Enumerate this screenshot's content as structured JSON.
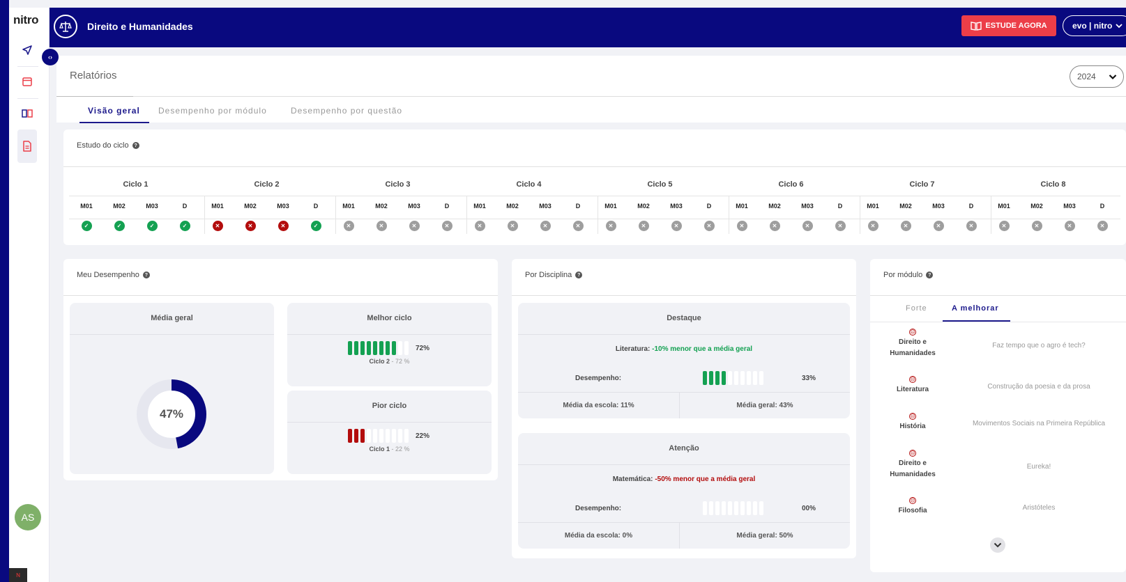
{
  "sidebar": {
    "logo": "nitro",
    "items": [
      {
        "name": "send-icon"
      },
      {
        "name": "calendar-icon"
      },
      {
        "name": "book-icon"
      },
      {
        "name": "report-icon",
        "active": true
      }
    ],
    "avatar_initials": "AS",
    "footer_logo": "nitro-badge-icon"
  },
  "header": {
    "course_title": "Direito e Humanidades",
    "study_button": "ESTUDE AGORA",
    "user_menu": "evo | nitro"
  },
  "page": {
    "title": "Relatórios",
    "year": "2024",
    "tabs": [
      "Visão geral",
      "Desempenho por módulo",
      "Desempenho por questão"
    ],
    "active_tab": "Visão geral"
  },
  "ciclo": {
    "title": "Estudo do ciclo",
    "modules": [
      "M01",
      "M02",
      "M03",
      "D"
    ],
    "cycles": [
      {
        "name": "Ciclo 1",
        "status": [
          "ok",
          "ok",
          "ok",
          "ok"
        ]
      },
      {
        "name": "Ciclo 2",
        "status": [
          "bad",
          "bad",
          "bad",
          "ok"
        ]
      },
      {
        "name": "Ciclo 3",
        "status": [
          "na",
          "na",
          "na",
          "na"
        ]
      },
      {
        "name": "Ciclo 4",
        "status": [
          "na",
          "na",
          "na",
          "na"
        ]
      },
      {
        "name": "Ciclo 5",
        "status": [
          "na",
          "na",
          "na",
          "na"
        ]
      },
      {
        "name": "Ciclo 6",
        "status": [
          "na",
          "na",
          "na",
          "na"
        ]
      },
      {
        "name": "Ciclo 7",
        "status": [
          "na",
          "na",
          "na",
          "na"
        ]
      },
      {
        "name": "Ciclo 8",
        "status": [
          "na",
          "na",
          "na",
          "na"
        ]
      }
    ]
  },
  "meu_desempenho": {
    "title": "Meu Desempenho",
    "media_geral_title": "Média geral",
    "media_geral_value": "47%",
    "media_geral_fraction": 0.47,
    "melhor_ciclo": {
      "title": "Melhor ciclo",
      "pct": "72%",
      "cycle": "Ciclo 2",
      "detail": " - 72 %",
      "filled": 8,
      "total": 10
    },
    "pior_ciclo": {
      "title": "Pior ciclo",
      "pct": "22%",
      "cycle": "Ciclo 1",
      "detail": " - 22 %",
      "filled": 3,
      "total": 10
    }
  },
  "por_disciplina": {
    "title": "Por Disciplina",
    "destaque": {
      "title": "Destaque",
      "subject": "Literatura:",
      "delta": "-10% menor que a média geral",
      "desempenho_label": "Desempenho:",
      "pct": "33%",
      "filled": 4,
      "total": 10,
      "media_escola": "Média da escola: 11%",
      "media_geral": "Média geral: 43%"
    },
    "atencao": {
      "title": "Atenção",
      "subject": "Matemática:",
      "delta": "-50% menor que a média geral",
      "desempenho_label": "Desempenho:",
      "pct": "00%",
      "filled": 0,
      "total": 10,
      "media_escola": "Média da escola: 0%",
      "media_geral": "Média geral: 50%"
    }
  },
  "por_modulo": {
    "title": "Por módulo",
    "tabs": [
      "Forte",
      "A melhorar"
    ],
    "active_tab": "A melhorar",
    "rows": [
      {
        "discipline": "Direito e Humanidades",
        "module": "Faz tempo que o agro é tech?"
      },
      {
        "discipline": "Literatura",
        "module": "Construção da poesia e da prosa"
      },
      {
        "discipline": "História",
        "module": "Movimentos Sociais na Primeira República"
      },
      {
        "discipline": "Direito e Humanidades",
        "module": "Eureka!"
      },
      {
        "discipline": "Filosofia",
        "module": "Aristóteles"
      }
    ]
  },
  "colors": {
    "primary": "#09097f",
    "accent_red": "#ec3e48",
    "success": "#14a152",
    "danger": "#b30d0d",
    "neutral": "#9e9e9e"
  }
}
